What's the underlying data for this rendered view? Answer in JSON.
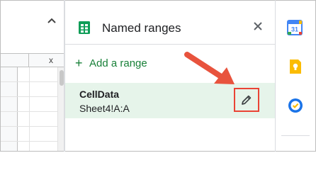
{
  "sheet": {
    "column_header_close": "x"
  },
  "panel": {
    "title": "Named ranges",
    "add_range_label": "Add a range",
    "add_range_symbol": "+",
    "ranges": [
      {
        "name": "CellData",
        "reference": "Sheet4!A:A"
      }
    ]
  },
  "icons": {
    "sheets": "sheets-icon",
    "close": "close-icon",
    "edit": "pencil-icon",
    "calendar": "calendar-icon",
    "keep": "keep-icon",
    "tasks": "tasks-icon",
    "collapse": "chevron-up-icon"
  },
  "colors": {
    "accent_green": "#188038",
    "selected_row_bg": "#e6f4ea",
    "highlight_red": "#ea4335"
  },
  "calendar_day": "31"
}
